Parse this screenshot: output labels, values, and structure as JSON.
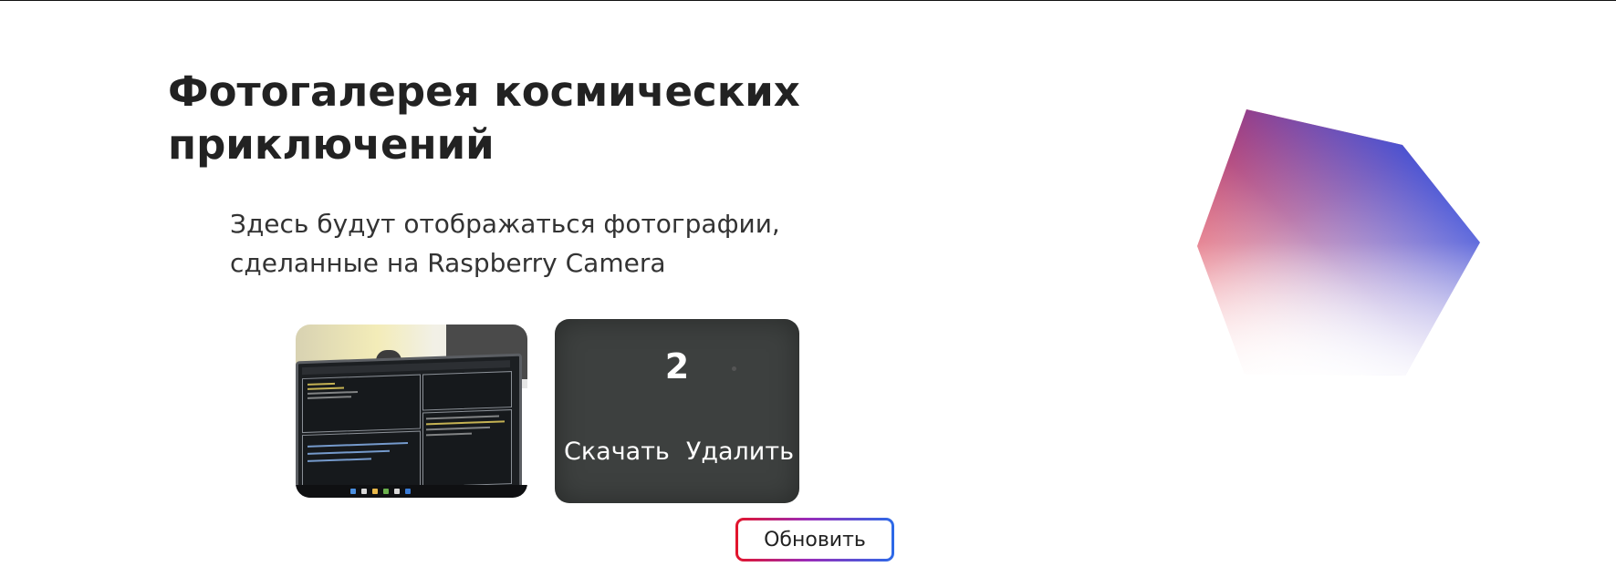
{
  "header": {
    "title": "Фотогалерея космических приключений",
    "subtitle": "Здесь будут отображаться фотографии, сделанные на Raspberry Camera"
  },
  "gallery": {
    "photos": [
      {
        "number": "",
        "content": "laptop-screen-photo"
      },
      {
        "number": "2",
        "download_label": "Скачать",
        "delete_label": "Удалить"
      }
    ]
  },
  "actions": {
    "refresh_label": "Обновить"
  },
  "decoration": {
    "shape": "hexagon-gradient",
    "colors": [
      "#e0121f",
      "#1e44e0",
      "#ffffff"
    ]
  },
  "colors": {
    "accent_red": "#e3142a",
    "accent_blue": "#2b6ae8",
    "card_bg": "#3d403f"
  }
}
